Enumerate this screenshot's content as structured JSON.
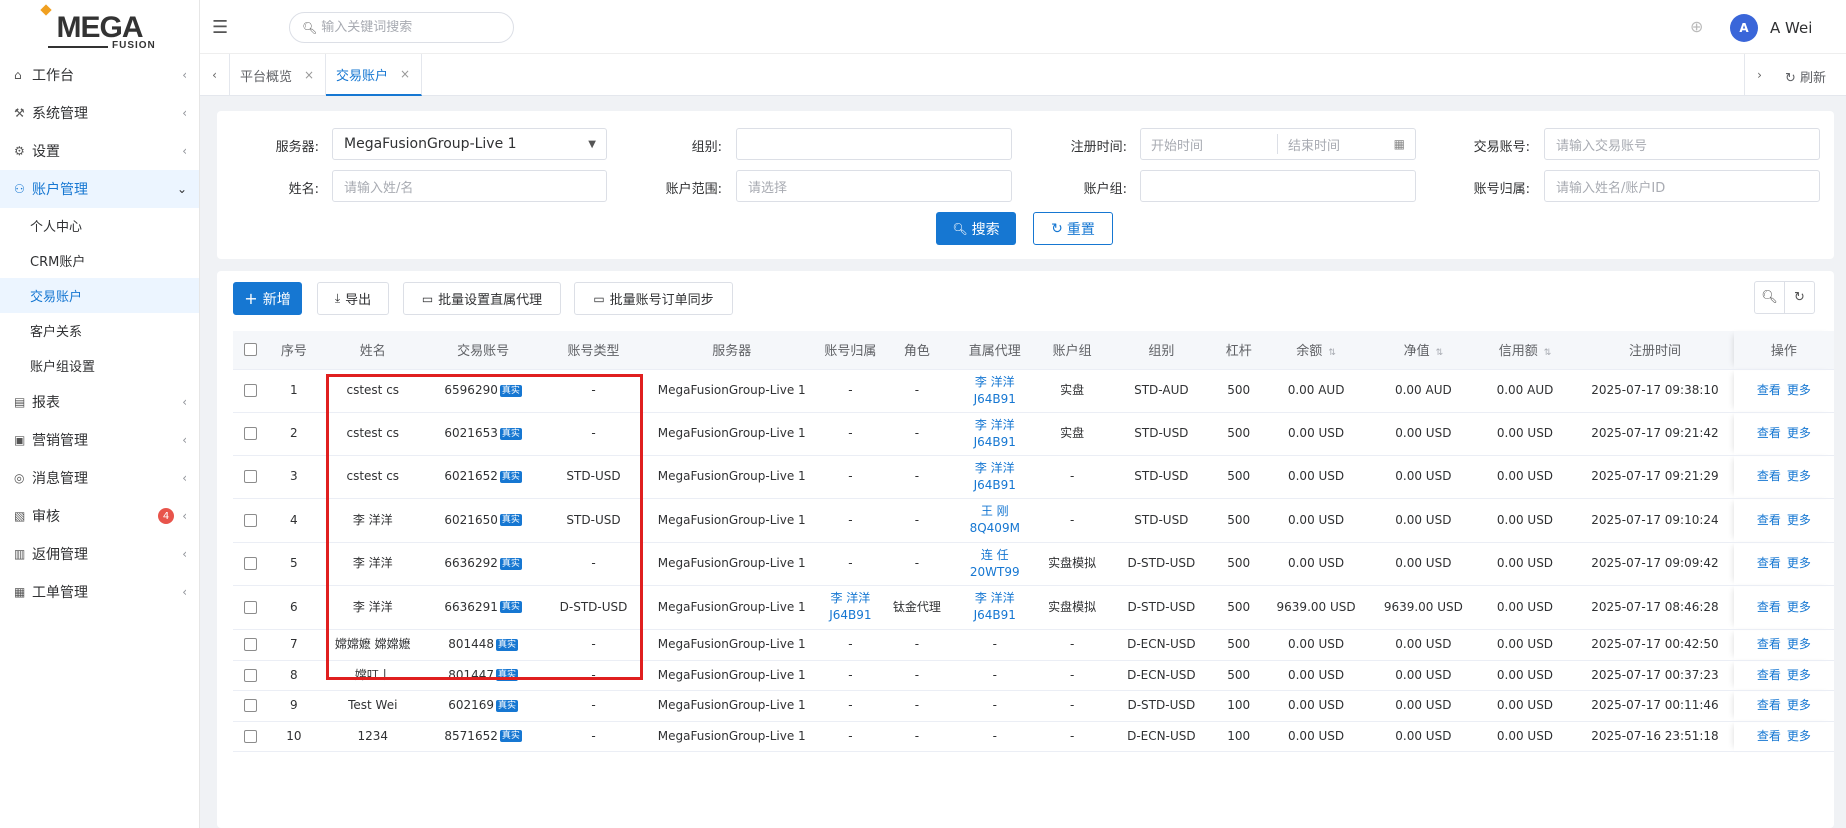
{
  "logo": {
    "word": "MEGA",
    "sub": "FUSION"
  },
  "sidebar": {
    "items": [
      {
        "label": "工作台",
        "icon": "home-icon",
        "glyph": "⌂"
      },
      {
        "label": "系统管理",
        "icon": "wrench-icon",
        "glyph": "⚒"
      },
      {
        "label": "设置",
        "icon": "gear-icon",
        "glyph": "⚙"
      },
      {
        "label": "账户管理",
        "icon": "user-icon",
        "glyph": "⚇"
      },
      {
        "label": "报表",
        "icon": "chart-icon",
        "glyph": "▤"
      },
      {
        "label": "营销管理",
        "icon": "gift-icon",
        "glyph": "▣"
      },
      {
        "label": "消息管理",
        "icon": "message-icon",
        "glyph": "◎"
      },
      {
        "label": "审核",
        "icon": "audit-icon",
        "glyph": "▧",
        "badge": "4"
      },
      {
        "label": "返佣管理",
        "icon": "rebate-icon",
        "glyph": "▥"
      },
      {
        "label": "工单管理",
        "icon": "ticket-icon",
        "glyph": "▦"
      }
    ],
    "sub_items": [
      "个人中心",
      "CRM账户",
      "交易账户",
      "客户关系",
      "账户组设置"
    ]
  },
  "header": {
    "search_placeholder": "输入关键词搜索",
    "avatar_letter": "A",
    "username": "A Wei"
  },
  "tabs": {
    "items": [
      "平台概览",
      "交易账户"
    ],
    "refresh": "刷新"
  },
  "filter": {
    "server_label": "服务器:",
    "server_value": "MegaFusionGroup-Live 1",
    "group_label": "组别:",
    "reg_time_label": "注册时间:",
    "start_placeholder": "开始时间",
    "end_placeholder": "结束时间",
    "account_label": "交易账号:",
    "account_placeholder": "请输入交易账号",
    "name_label": "姓名:",
    "name_placeholder": "请输入姓/名",
    "range_label": "账户范围:",
    "range_placeholder": "请选择",
    "acct_group_label": "账户组:",
    "owner_label": "账号归属:",
    "owner_placeholder": "请输入姓名/账户ID",
    "search_btn": "搜索",
    "reset_btn": "重置"
  },
  "toolbar": {
    "add": "新增",
    "export": "导出",
    "batch_agent": "批量设置直属代理",
    "batch_sync": "批量账号订单同步"
  },
  "table": {
    "columns": [
      "序号",
      "姓名",
      "交易账号",
      "账号类型",
      "服务器",
      "账号归属",
      "角色",
      "直属代理",
      "账户组",
      "组别",
      "杠杆",
      "余额",
      "净值",
      "信用额",
      "注册时间",
      "操作"
    ],
    "tag": "真实",
    "view": "查看",
    "more": "更多",
    "rows": [
      {
        "no": "1",
        "name": "cstest cs",
        "account": "6596290",
        "type": "-",
        "server": "MegaFusionGroup-Live 1",
        "owner": "-",
        "owner2": "",
        "role": "-",
        "agent": "李 洋洋",
        "agent2": "J64B91",
        "acct_group": "实盘",
        "group": "STD-AUD",
        "leverage": "500",
        "balance": "0.00 AUD",
        "equity": "0.00 AUD",
        "credit": "0.00 AUD",
        "reg_time": "2025-07-17 09:38:10"
      },
      {
        "no": "2",
        "name": "cstest cs",
        "account": "6021653",
        "type": "-",
        "server": "MegaFusionGroup-Live 1",
        "owner": "-",
        "owner2": "",
        "role": "-",
        "agent": "李 洋洋",
        "agent2": "J64B91",
        "acct_group": "实盘",
        "group": "STD-USD",
        "leverage": "500",
        "balance": "0.00 USD",
        "equity": "0.00 USD",
        "credit": "0.00 USD",
        "reg_time": "2025-07-17 09:21:42"
      },
      {
        "no": "3",
        "name": "cstest cs",
        "account": "6021652",
        "type": "STD-USD",
        "server": "MegaFusionGroup-Live 1",
        "owner": "-",
        "owner2": "",
        "role": "-",
        "agent": "李 洋洋",
        "agent2": "J64B91",
        "acct_group": "-",
        "group": "STD-USD",
        "leverage": "500",
        "balance": "0.00 USD",
        "equity": "0.00 USD",
        "credit": "0.00 USD",
        "reg_time": "2025-07-17 09:21:29"
      },
      {
        "no": "4",
        "name": "李 洋洋",
        "account": "6021650",
        "type": "STD-USD",
        "server": "MegaFusionGroup-Live 1",
        "owner": "-",
        "owner2": "",
        "role": "-",
        "agent": "王 刚",
        "agent2": "8Q409M",
        "acct_group": "-",
        "group": "STD-USD",
        "leverage": "500",
        "balance": "0.00 USD",
        "equity": "0.00 USD",
        "credit": "0.00 USD",
        "reg_time": "2025-07-17 09:10:24"
      },
      {
        "no": "5",
        "name": "李 洋洋",
        "account": "6636292",
        "type": "-",
        "server": "MegaFusionGroup-Live 1",
        "owner": "-",
        "owner2": "",
        "role": "-",
        "agent": "连 任",
        "agent2": "20WT99",
        "acct_group": "实盘模拟",
        "group": "D-STD-USD",
        "leverage": "500",
        "balance": "0.00 USD",
        "equity": "0.00 USD",
        "credit": "0.00 USD",
        "reg_time": "2025-07-17 09:09:42"
      },
      {
        "no": "6",
        "name": "李 洋洋",
        "account": "6636291",
        "type": "D-STD-USD",
        "server": "MegaFusionGroup-Live 1",
        "owner": "李 洋洋",
        "owner2": "J64B91",
        "role": "钛金代理",
        "agent": "李 洋洋",
        "agent2": "J64B91",
        "acct_group": "实盘模拟",
        "group": "D-STD-USD",
        "leverage": "500",
        "balance": "9639.00 USD",
        "equity": "9639.00 USD",
        "credit": "0.00 USD",
        "reg_time": "2025-07-17 08:46:28"
      },
      {
        "no": "7",
        "name": "嫦嫦嬷 嫦嫦嬷",
        "account": "801448",
        "type": "-",
        "server": "MegaFusionGroup-Live 1",
        "owner": "-",
        "owner2": "",
        "role": "-",
        "agent": "-",
        "agent2": "",
        "acct_group": "-",
        "group": "D-ECN-USD",
        "leverage": "500",
        "balance": "0.00 USD",
        "equity": "0.00 USD",
        "credit": "0.00 USD",
        "reg_time": "2025-07-17 00:42:50"
      },
      {
        "no": "8",
        "name": "嫦叮丨",
        "account": "801447",
        "type": "-",
        "server": "MegaFusionGroup-Live 1",
        "owner": "-",
        "owner2": "",
        "role": "-",
        "agent": "-",
        "agent2": "",
        "acct_group": "-",
        "group": "D-ECN-USD",
        "leverage": "500",
        "balance": "0.00 USD",
        "equity": "0.00 USD",
        "credit": "0.00 USD",
        "reg_time": "2025-07-17 00:37:23"
      },
      {
        "no": "9",
        "name": "Test Wei",
        "account": "602169",
        "type": "-",
        "server": "MegaFusionGroup-Live 1",
        "owner": "-",
        "owner2": "",
        "role": "-",
        "agent": "-",
        "agent2": "",
        "acct_group": "-",
        "group": "D-STD-USD",
        "leverage": "100",
        "balance": "0.00 USD",
        "equity": "0.00 USD",
        "credit": "0.00 USD",
        "reg_time": "2025-07-17 00:11:46"
      },
      {
        "no": "10",
        "name": "1234",
        "account": "8571652",
        "type": "-",
        "server": "MegaFusionGroup-Live 1",
        "owner": "-",
        "owner2": "",
        "role": "-",
        "agent": "-",
        "agent2": "",
        "acct_group": "-",
        "group": "D-ECN-USD",
        "leverage": "100",
        "balance": "0.00 USD",
        "equity": "0.00 USD",
        "credit": "0.00 USD",
        "reg_time": "2025-07-16 23:51:18"
      }
    ]
  },
  "colors": {
    "primary": "#1677d2",
    "highlight_box": "#e01f1f",
    "badge": "#e8544b"
  }
}
